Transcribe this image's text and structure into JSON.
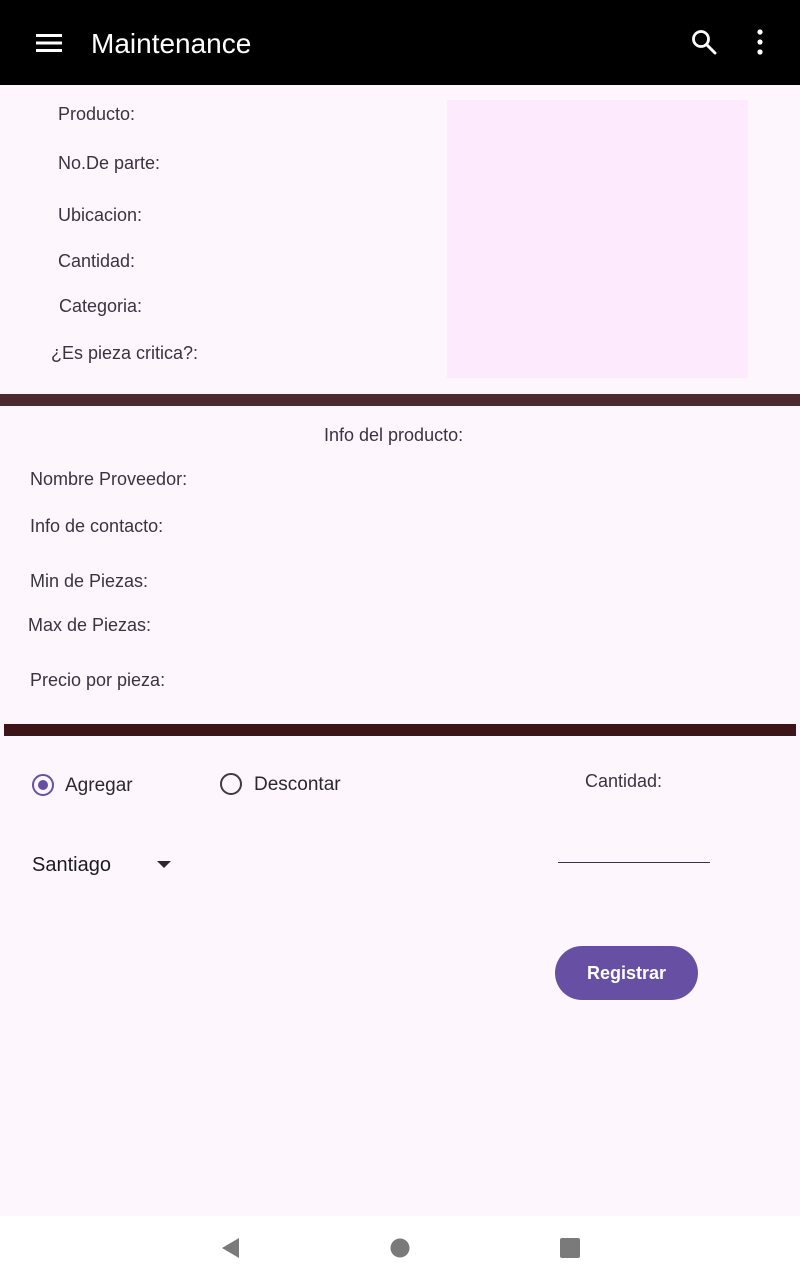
{
  "app_bar": {
    "title": "Maintenance",
    "icons": [
      "menu-icon",
      "search-icon",
      "more-vert-icon"
    ],
    "background": "#000000"
  },
  "product_fields": {
    "producto": "Producto:",
    "no_parte": "No.De parte:",
    "ubicacion": "Ubicacion:",
    "cantidad": "Cantidad:",
    "categoria": "Categoria:",
    "pieza_critica": "¿Es pieza critica?:"
  },
  "product_info": {
    "header": "Info del producto:",
    "nombre_proveedor": "Nombre Proveedor:",
    "info_contacto": "Info de contacto:",
    "min_piezas": "Min de Piezas:",
    "max_piezas": "Max de Piezas:",
    "precio_pieza": "Precio por pieza:"
  },
  "operation": {
    "options": [
      {
        "label": "Agregar",
        "selected": true
      },
      {
        "label": "Descontar",
        "selected": false
      }
    ],
    "cantidad_label": "Cantidad:",
    "cantidad_value": "",
    "location_selected": "Santiago",
    "submit_label": "Registrar"
  },
  "colors": {
    "accent": "#6750a4",
    "background": "#fdf7fd",
    "image_placeholder": "#fdeafc",
    "divider_top": "#4c2a2e",
    "divider_bottom": "#3d1518"
  },
  "system_nav": {
    "icons": [
      "back-icon",
      "home-icon",
      "recents-icon"
    ]
  }
}
